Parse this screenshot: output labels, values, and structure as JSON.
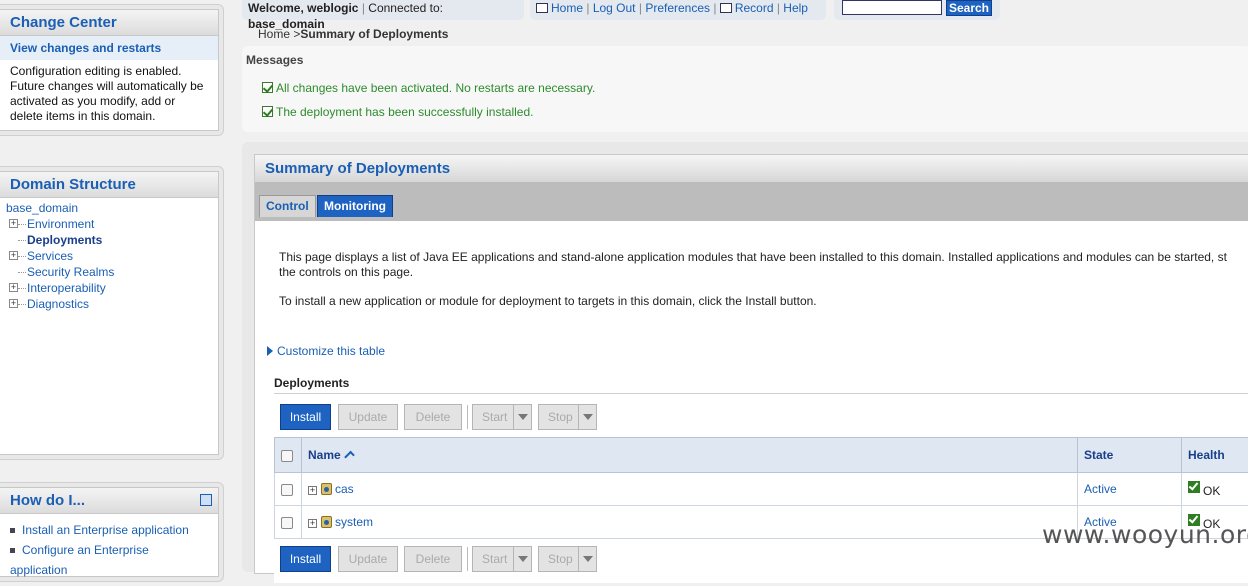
{
  "change_center": {
    "title": "Change Center",
    "subtitle": "View changes and restarts",
    "text_lines": [
      "Configuration editing is enabled.",
      "Future changes will automatically be",
      "activated as you modify, add or",
      "delete items in this domain."
    ]
  },
  "domain_structure": {
    "title": "Domain Structure",
    "root": "base_domain",
    "items": [
      {
        "label": "Environment",
        "expandable": "+"
      },
      {
        "label": "Deployments",
        "expandable": ""
      },
      {
        "label": "Services",
        "expandable": "+"
      },
      {
        "label": "Security Realms",
        "expandable": ""
      },
      {
        "label": "Interoperability",
        "expandable": "+"
      },
      {
        "label": "Diagnostics",
        "expandable": "+"
      }
    ]
  },
  "how_do_i": {
    "title": "How do I...",
    "items": [
      "Install an Enterprise application",
      "Configure an Enterprise application"
    ]
  },
  "topbar": {
    "welcome_prefix": "Welcome, ",
    "user": "weblogic",
    "connected_prefix": "Connected to: ",
    "domain": "base_domain",
    "links": [
      "Home",
      "Log Out",
      "Preferences",
      "Record",
      "Help"
    ],
    "search_value": "",
    "search_button": "Search"
  },
  "breadcrumb": {
    "home": "Home",
    "separator": ">",
    "current": "Summary of Deployments"
  },
  "messages": {
    "title": "Messages",
    "items": [
      "All changes have been activated. No restarts are necessary.",
      "The deployment has been successfully installed."
    ]
  },
  "summary": {
    "title": "Summary of Deployments",
    "tabs": [
      "Control",
      "Monitoring"
    ],
    "description_lines": [
      "This page displays a list of Java EE applications and stand-alone application modules that have been installed to this domain. Installed applications and modules can be started, st",
      "the controls on this page."
    ],
    "install_hint": "To install a new application or module for deployment to targets in this domain, click the Install button.",
    "customize_link": "Customize this table",
    "deployments_title": "Deployments",
    "buttons": {
      "install": "Install",
      "update": "Update",
      "delete": "Delete",
      "start": "Start",
      "stop": "Stop"
    },
    "columns": {
      "name": "Name",
      "state": "State",
      "health": "Health"
    },
    "rows": [
      {
        "name": "cas",
        "state": "Active",
        "health": "OK"
      },
      {
        "name": "system",
        "state": "Active",
        "health": "OK"
      }
    ]
  },
  "watermark": "www.wooyun.org"
}
